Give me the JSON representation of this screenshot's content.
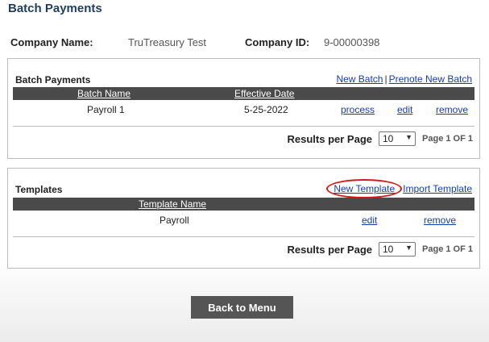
{
  "page": {
    "title": "Batch Payments"
  },
  "company": {
    "name_label": "Company Name:",
    "name_value": "TruTreasury Test",
    "id_label": "Company ID:",
    "id_value": "9-00000398"
  },
  "batch_panel": {
    "title": "Batch Payments",
    "link_new_batch": "New Batch",
    "separator": "|",
    "link_prenote_new_batch": "Prenote New Batch",
    "columns": [
      "Batch Name",
      "Effective Date"
    ],
    "rows": [
      {
        "batch_name": "Payroll 1",
        "effective_date": "5-25-2022",
        "action_process": "process",
        "action_edit": "edit",
        "action_remove": "remove"
      }
    ],
    "pager": {
      "results_label": "Results per Page",
      "per_page": "10",
      "page_text": "Page 1 OF 1"
    }
  },
  "templates_panel": {
    "title": "Templates",
    "link_new_template": "New Template",
    "link_import_template": "Import Template",
    "columns": [
      "Template Name"
    ],
    "rows": [
      {
        "template_name": "Payroll",
        "action_edit": "edit",
        "action_remove": "remove"
      }
    ],
    "pager": {
      "results_label": "Results per Page",
      "per_page": "10",
      "page_text": "Page 1 OF 1"
    }
  },
  "footer": {
    "back_button": "Back to Menu"
  },
  "colors": {
    "title": "#1f3d5c",
    "link": "#1a3caa",
    "header_bar": "#4a4a4a",
    "button": "#555555",
    "highlight_circle": "#d01a1a"
  },
  "icons": {
    "select_arrow": "chevron-down-icon"
  }
}
